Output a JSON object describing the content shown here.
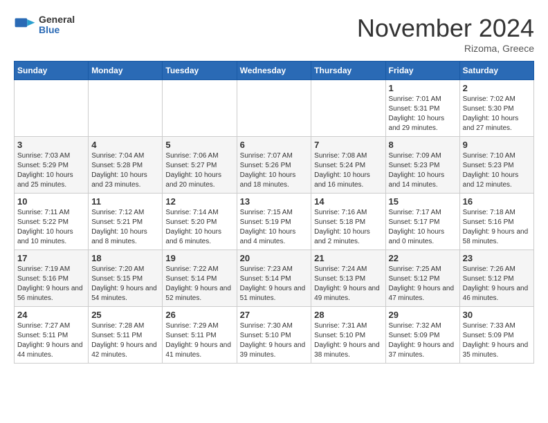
{
  "header": {
    "logo_general": "General",
    "logo_blue": "Blue",
    "month_title": "November 2024",
    "location": "Rizoma, Greece"
  },
  "weekdays": [
    "Sunday",
    "Monday",
    "Tuesday",
    "Wednesday",
    "Thursday",
    "Friday",
    "Saturday"
  ],
  "weeks": [
    [
      {
        "day": "",
        "info": ""
      },
      {
        "day": "",
        "info": ""
      },
      {
        "day": "",
        "info": ""
      },
      {
        "day": "",
        "info": ""
      },
      {
        "day": "",
        "info": ""
      },
      {
        "day": "1",
        "info": "Sunrise: 7:01 AM\nSunset: 5:31 PM\nDaylight: 10 hours and 29 minutes."
      },
      {
        "day": "2",
        "info": "Sunrise: 7:02 AM\nSunset: 5:30 PM\nDaylight: 10 hours and 27 minutes."
      }
    ],
    [
      {
        "day": "3",
        "info": "Sunrise: 7:03 AM\nSunset: 5:29 PM\nDaylight: 10 hours and 25 minutes."
      },
      {
        "day": "4",
        "info": "Sunrise: 7:04 AM\nSunset: 5:28 PM\nDaylight: 10 hours and 23 minutes."
      },
      {
        "day": "5",
        "info": "Sunrise: 7:06 AM\nSunset: 5:27 PM\nDaylight: 10 hours and 20 minutes."
      },
      {
        "day": "6",
        "info": "Sunrise: 7:07 AM\nSunset: 5:26 PM\nDaylight: 10 hours and 18 minutes."
      },
      {
        "day": "7",
        "info": "Sunrise: 7:08 AM\nSunset: 5:24 PM\nDaylight: 10 hours and 16 minutes."
      },
      {
        "day": "8",
        "info": "Sunrise: 7:09 AM\nSunset: 5:23 PM\nDaylight: 10 hours and 14 minutes."
      },
      {
        "day": "9",
        "info": "Sunrise: 7:10 AM\nSunset: 5:23 PM\nDaylight: 10 hours and 12 minutes."
      }
    ],
    [
      {
        "day": "10",
        "info": "Sunrise: 7:11 AM\nSunset: 5:22 PM\nDaylight: 10 hours and 10 minutes."
      },
      {
        "day": "11",
        "info": "Sunrise: 7:12 AM\nSunset: 5:21 PM\nDaylight: 10 hours and 8 minutes."
      },
      {
        "day": "12",
        "info": "Sunrise: 7:14 AM\nSunset: 5:20 PM\nDaylight: 10 hours and 6 minutes."
      },
      {
        "day": "13",
        "info": "Sunrise: 7:15 AM\nSunset: 5:19 PM\nDaylight: 10 hours and 4 minutes."
      },
      {
        "day": "14",
        "info": "Sunrise: 7:16 AM\nSunset: 5:18 PM\nDaylight: 10 hours and 2 minutes."
      },
      {
        "day": "15",
        "info": "Sunrise: 7:17 AM\nSunset: 5:17 PM\nDaylight: 10 hours and 0 minutes."
      },
      {
        "day": "16",
        "info": "Sunrise: 7:18 AM\nSunset: 5:16 PM\nDaylight: 9 hours and 58 minutes."
      }
    ],
    [
      {
        "day": "17",
        "info": "Sunrise: 7:19 AM\nSunset: 5:16 PM\nDaylight: 9 hours and 56 minutes."
      },
      {
        "day": "18",
        "info": "Sunrise: 7:20 AM\nSunset: 5:15 PM\nDaylight: 9 hours and 54 minutes."
      },
      {
        "day": "19",
        "info": "Sunrise: 7:22 AM\nSunset: 5:14 PM\nDaylight: 9 hours and 52 minutes."
      },
      {
        "day": "20",
        "info": "Sunrise: 7:23 AM\nSunset: 5:14 PM\nDaylight: 9 hours and 51 minutes."
      },
      {
        "day": "21",
        "info": "Sunrise: 7:24 AM\nSunset: 5:13 PM\nDaylight: 9 hours and 49 minutes."
      },
      {
        "day": "22",
        "info": "Sunrise: 7:25 AM\nSunset: 5:12 PM\nDaylight: 9 hours and 47 minutes."
      },
      {
        "day": "23",
        "info": "Sunrise: 7:26 AM\nSunset: 5:12 PM\nDaylight: 9 hours and 46 minutes."
      }
    ],
    [
      {
        "day": "24",
        "info": "Sunrise: 7:27 AM\nSunset: 5:11 PM\nDaylight: 9 hours and 44 minutes."
      },
      {
        "day": "25",
        "info": "Sunrise: 7:28 AM\nSunset: 5:11 PM\nDaylight: 9 hours and 42 minutes."
      },
      {
        "day": "26",
        "info": "Sunrise: 7:29 AM\nSunset: 5:11 PM\nDaylight: 9 hours and 41 minutes."
      },
      {
        "day": "27",
        "info": "Sunrise: 7:30 AM\nSunset: 5:10 PM\nDaylight: 9 hours and 39 minutes."
      },
      {
        "day": "28",
        "info": "Sunrise: 7:31 AM\nSunset: 5:10 PM\nDaylight: 9 hours and 38 minutes."
      },
      {
        "day": "29",
        "info": "Sunrise: 7:32 AM\nSunset: 5:09 PM\nDaylight: 9 hours and 37 minutes."
      },
      {
        "day": "30",
        "info": "Sunrise: 7:33 AM\nSunset: 5:09 PM\nDaylight: 9 hours and 35 minutes."
      }
    ]
  ]
}
